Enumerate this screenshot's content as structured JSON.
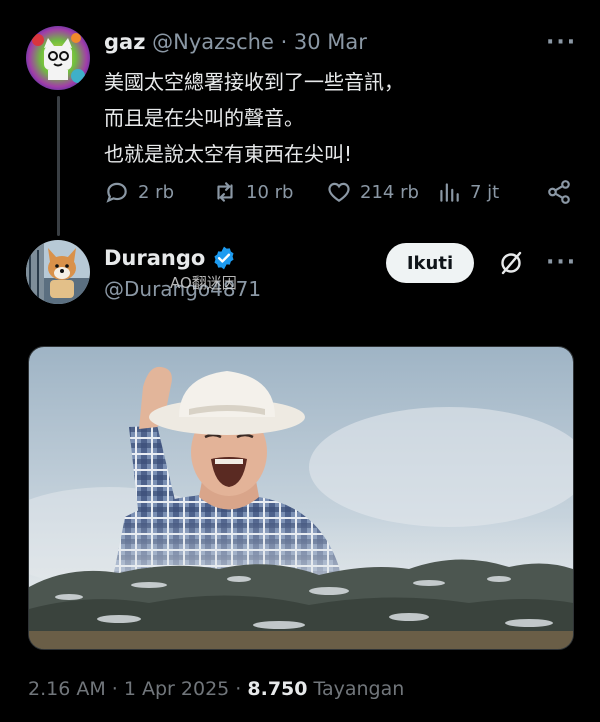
{
  "tweet1": {
    "name": "gaz",
    "handle": "@Nyazsche",
    "date": "· 30 Mar",
    "lines": [
      "美國太空總署接收到了一些音訊，",
      "而且是在尖叫的聲音。",
      "也就是說太空有東西在尖叫!"
    ],
    "more_label": "···",
    "actions": {
      "replies": "2 rb",
      "reposts": "10 rb",
      "likes": "214 rb",
      "views": "7 jt"
    }
  },
  "tweet2": {
    "name": "Durango",
    "handle": "@Durango4871",
    "watermark": "AO翻迷因",
    "follow_label": "Ikuti",
    "more_label": "···",
    "verified_color": "#1d9bf0"
  },
  "footer": {
    "time": "2.16 AM · 1 Apr 2025 · ",
    "views_count": "8.750",
    "views_label": " Tayangan"
  },
  "colors": {
    "background": "#000000",
    "text": "#e7e9ea",
    "muted": "#8b98a5"
  }
}
